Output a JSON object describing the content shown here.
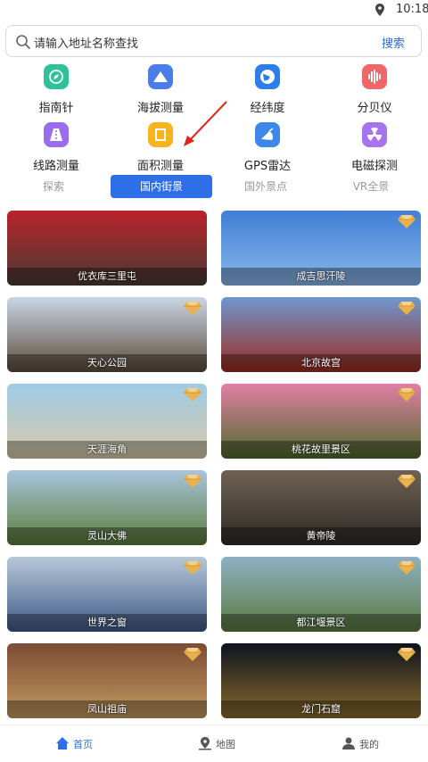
{
  "status": {
    "time": "10:18"
  },
  "search": {
    "placeholder": "请输入地址名称查找",
    "button": "搜索"
  },
  "tools": [
    {
      "label": "指南针",
      "icon": "compass-icon",
      "color": "#2ec29a"
    },
    {
      "label": "海拔测量",
      "icon": "mountain-icon",
      "color": "#4a7de8"
    },
    {
      "label": "经纬度",
      "icon": "globe-icon",
      "color": "#2f7de8"
    },
    {
      "label": "分贝仪",
      "icon": "sound-wave-icon",
      "color": "#f0676a"
    },
    {
      "label": "线路测量",
      "icon": "road-icon",
      "color": "#9a6cf0"
    },
    {
      "label": "面积测量",
      "icon": "area-icon",
      "color": "#f6b51e"
    },
    {
      "label": "GPS雷达",
      "icon": "radar-icon",
      "color": "#3d86ea"
    },
    {
      "label": "电磁探测",
      "icon": "radiation-icon",
      "color": "#a873f0"
    }
  ],
  "tabs": [
    {
      "label": "探索",
      "active": false
    },
    {
      "label": "国内街景",
      "active": true
    },
    {
      "label": "国外景点",
      "active": false
    },
    {
      "label": "VR全景",
      "active": false
    }
  ],
  "places": [
    {
      "name": "优衣库三里屯",
      "premium": false,
      "colors": [
        "#b8232a",
        "#4a3a36"
      ]
    },
    {
      "name": "成吉思汗陵",
      "premium": true,
      "colors": [
        "#3f7fd6",
        "#8ab6ea"
      ]
    },
    {
      "name": "天心公园",
      "premium": true,
      "colors": [
        "#c9d6e6",
        "#5d4c3b"
      ]
    },
    {
      "name": "北京故宫",
      "premium": true,
      "colors": [
        "#6f96cf",
        "#9c2d1f"
      ]
    },
    {
      "name": "天涯海角",
      "premium": true,
      "colors": [
        "#9ecbe8",
        "#d9c9a7"
      ]
    },
    {
      "name": "桃花故里景区",
      "premium": true,
      "colors": [
        "#e27fa5",
        "#4d6b2c"
      ]
    },
    {
      "name": "灵山大佛",
      "premium": true,
      "colors": [
        "#a8c4de",
        "#5c7d3a"
      ]
    },
    {
      "name": "黄帝陵",
      "premium": true,
      "colors": [
        "#6f6154",
        "#2d2a26"
      ]
    },
    {
      "name": "世界之窗",
      "premium": true,
      "colors": [
        "#b7c8d8",
        "#3f5a86"
      ]
    },
    {
      "name": "都江堰景区",
      "premium": true,
      "colors": [
        "#8fb0c4",
        "#5a7a3e"
      ]
    },
    {
      "name": "凤山祖庙",
      "premium": true,
      "colors": [
        "#7c4b34",
        "#c29a5e"
      ]
    },
    {
      "name": "龙门石窟",
      "premium": true,
      "colors": [
        "#0d1420",
        "#8a6a2c"
      ]
    }
  ],
  "bottom_nav": [
    {
      "label": "首页",
      "icon": "home-icon",
      "active": true
    },
    {
      "label": "地图",
      "icon": "map-pin-icon",
      "active": false
    },
    {
      "label": "我的",
      "icon": "user-icon",
      "active": false
    }
  ],
  "colors": {
    "accent": "#2e6ee6",
    "premium_gem": "#e9b24a"
  }
}
